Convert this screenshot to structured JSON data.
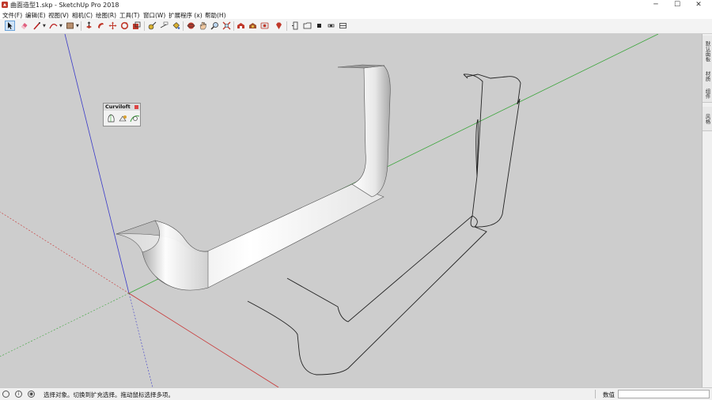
{
  "window": {
    "title": "曲面造型1.skp - SketchUp Pro 2018",
    "minimize_label": "─",
    "maximize_label": "☐",
    "close_label": "✕"
  },
  "menu": {
    "items": [
      {
        "label": "文件(F)"
      },
      {
        "label": "编辑(E)"
      },
      {
        "label": "视图(V)"
      },
      {
        "label": "相机(C)"
      },
      {
        "label": "绘图(R)"
      },
      {
        "label": "工具(T)"
      },
      {
        "label": "窗口(W)"
      },
      {
        "label": "扩展程序 (x)"
      },
      {
        "label": "帮助(H)"
      }
    ]
  },
  "toolbar": {
    "tools": [
      "select-icon",
      "eraser-icon",
      "line-icon",
      "arc-icon",
      "rectangle-icon",
      "push-pull-icon",
      "follow-me-icon",
      "move-icon",
      "rotate-icon",
      "scale-icon",
      "tape-measure-icon",
      "dimension-icon",
      "paint-bucket-icon",
      "orbit-icon",
      "pan-icon",
      "zoom-icon",
      "zoom-extents-icon",
      "warehouse-icon",
      "extension-warehouse-icon",
      "layout-icon",
      "ruby-icon",
      "section-plane-icon",
      "section-display-icon",
      "section-cut-icon",
      "section-fill-icon",
      "section-box-icon"
    ]
  },
  "trays": {
    "tabs": [
      {
        "label": "默认面板"
      },
      {
        "label": "材质"
      },
      {
        "label": "组件"
      },
      {
        "label": "风格"
      }
    ]
  },
  "curviloft": {
    "title": "Curviloft",
    "tools": [
      "loft-by-spline-icon",
      "skin-contours-icon",
      "loft-along-path-icon"
    ]
  },
  "status": {
    "message": "选择对象。切换到扩充选择。拖动鼠标选择多项。",
    "measurements_label": "数值",
    "measurements_value": ""
  },
  "colors": {
    "viewport_bg": "#cdcdcd",
    "axis_red": "#c83232",
    "axis_green": "#3aa53a",
    "axis_blue": "#3a3ac8",
    "toolbar_bg": "#f3f3f3"
  }
}
